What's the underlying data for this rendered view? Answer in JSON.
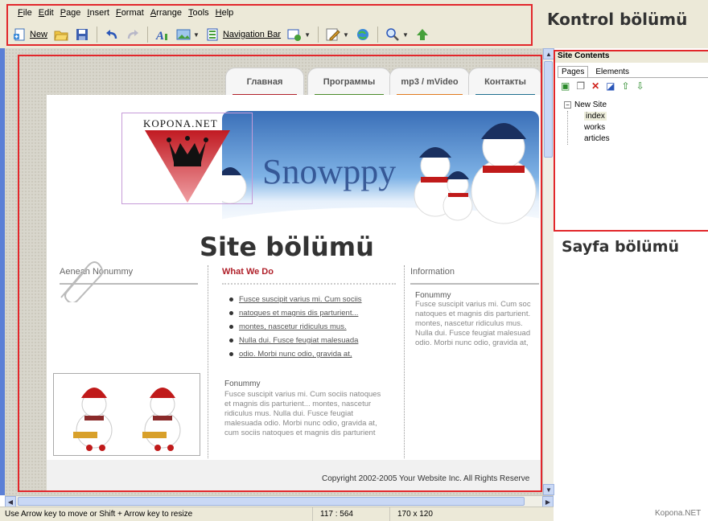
{
  "menu": [
    "File",
    "Edit",
    "Page",
    "Insert",
    "Format",
    "Arrange",
    "Tools",
    "Help"
  ],
  "toolbar": {
    "new_label": "New",
    "navbar_label": "Navigation Bar",
    "icons": [
      "new-page-icon",
      "open-folder-icon",
      "save-icon",
      "undo-icon",
      "redo-icon",
      "text-icon",
      "image-icon",
      "navigation-bar-icon",
      "add-element-icon",
      "edit-icon",
      "publish-icon",
      "zoom-icon",
      "upload-icon"
    ]
  },
  "annotations": {
    "control": "Kontrol bölümü",
    "site": "Site bölümü",
    "page": "Sayfa bölümü"
  },
  "site": {
    "nav_tabs": [
      {
        "label": "Главная",
        "color": "#b0202a"
      },
      {
        "label": "Программы",
        "color": "#4a8a2a"
      },
      {
        "label": "mp3 / mVideo",
        "color": "#e07a1f"
      },
      {
        "label": "Контакты",
        "color": "#1f6f8f"
      }
    ],
    "logo_text": "KOPONA.NET",
    "banner_text": "Snowppy",
    "col1_heading": "Aenean Nonummy",
    "col2_heading": "What We Do",
    "col3_heading": "Information",
    "links": [
      "Fusce suscipit varius mi. Cum sociis",
      "natoques et magnis dis parturient...",
      "montes, nascetur ridiculus mus.",
      "Nulla dui. Fusce feugiat malesuada",
      "odio. Morbi nunc odio, gravida at,"
    ],
    "col2_sub_heading": "Fonummy",
    "col2_text": [
      "Fusce suscipit varius mi. Cum sociis natoques",
      "et magnis dis parturient... montes, nascetur",
      "ridiculus mus. Nulla dui. Fusce feugiat",
      "malesuada odio. Morbi nunc odio, gravida at,",
      "cum sociis natoques et magnis dis parturient"
    ],
    "col3_sub_heading": "Fonummy",
    "col3_text": [
      "Fusce suscipit varius mi. Cum soc",
      "natoques et magnis dis parturient.",
      "montes, nascetur ridiculus mus.",
      "Nulla dui. Fusce feugiat malesuad",
      "odio. Morbi nunc odio, gravida at,"
    ],
    "copyright": "Copyright 2002-2005 Your Website  Inc. All Rights Reserve"
  },
  "panel": {
    "title": "Site Contents",
    "tabs": [
      "Pages",
      "Elements"
    ],
    "tree_root": "New Site",
    "pages": [
      "index",
      "works",
      "articles"
    ],
    "selected_page": "index"
  },
  "status": {
    "hint": "Use Arrow key to move or Shift + Arrow key to resize",
    "position": "117 : 564",
    "size": "170 x 120"
  },
  "watermark": "Kopona.NET"
}
